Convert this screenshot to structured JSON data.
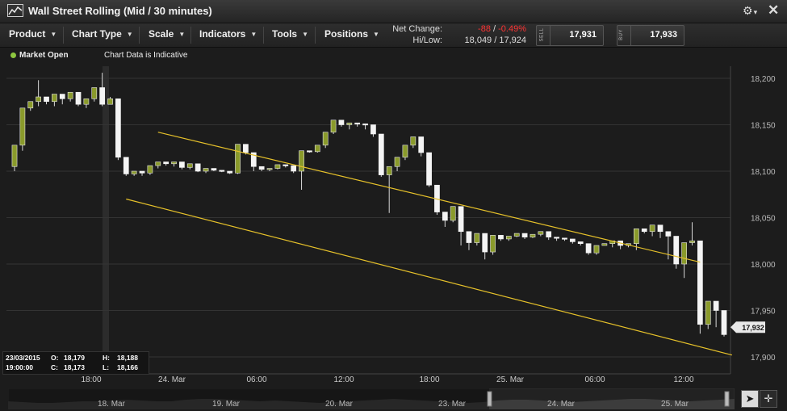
{
  "window": {
    "title": "Wall Street Rolling (Mid / 30 minutes)",
    "gear_icon": "gear-icon",
    "close_icon": "close-icon"
  },
  "toolbar": {
    "menus": [
      {
        "label": "Product"
      },
      {
        "label": "Chart Type"
      },
      {
        "label": "Scale"
      },
      {
        "label": "Indicators"
      },
      {
        "label": "Tools"
      },
      {
        "label": "Positions"
      }
    ],
    "net_change_label": "Net Change:",
    "net_change_points": "-88",
    "net_change_sep": "/",
    "net_change_pct": "-0.49%",
    "hilow_label": "Hi/Low:",
    "hilow_value": "18,049 / 17,924",
    "sell_label": "SELL",
    "sell_price": "17,931",
    "buy_label": "BUY",
    "buy_price": "17,933"
  },
  "status": {
    "market": "Market Open",
    "note": "Chart Data is Indicative",
    "market_color": "#8dc63f"
  },
  "ohlc_panel": {
    "date": "23/03/2015",
    "time": "19:00:00",
    "o_label": "O:",
    "o": "18,179",
    "c_label": "C:",
    "c": "18,173",
    "h_label": "H:",
    "h": "18,188",
    "l_label": "L:",
    "l": "18,166"
  },
  "chart_data": {
    "type": "candlestick",
    "title": "Wall Street Rolling (Mid / 30 minutes)",
    "y_ticks": [
      "18,200",
      "18,150",
      "18,100",
      "18,050",
      "18,000",
      "17,950",
      "17,900"
    ],
    "y_tick_values": [
      18200,
      18150,
      18100,
      18050,
      18000,
      17950,
      17900
    ],
    "ylim": [
      17885,
      18225
    ],
    "current_price": 17932,
    "current_price_label": "17,932",
    "x_ticks": [
      "18:00",
      "24. Mar",
      "06:00",
      "12:00",
      "18:00",
      "25. Mar",
      "06:00",
      "12:00"
    ],
    "bull_color": "#8a9a2b",
    "bear_color": "#f4f4f4",
    "candles": [
      [
        18105,
        18128,
        18100,
        18100
      ],
      [
        18128,
        18168,
        18122,
        18122
      ],
      [
        18168,
        18175,
        18165,
        18160
      ],
      [
        18175,
        18180,
        18170,
        18198
      ],
      [
        18180,
        18175,
        18172,
        18172
      ],
      [
        18175,
        18183,
        18170,
        18170
      ],
      [
        18183,
        18178,
        18172,
        18172
      ],
      [
        18178,
        18185,
        18175,
        18175
      ],
      [
        18185,
        18172,
        18170,
        18170
      ],
      [
        18172,
        18178,
        18168,
        18168
      ],
      [
        18178,
        18190,
        18175,
        18175
      ],
      [
        18190,
        18172,
        18170,
        18206
      ],
      [
        18172,
        18178,
        18172,
        18180
      ],
      [
        18178,
        18115,
        18112,
        18112
      ],
      [
        18115,
        18097,
        18095,
        18095
      ],
      [
        18097,
        18100,
        18095,
        18092
      ],
      [
        18100,
        18098,
        18095,
        18093
      ],
      [
        18098,
        18106,
        18096,
        18096
      ],
      [
        18106,
        18110,
        18103,
        18103
      ],
      [
        18110,
        18108,
        18106,
        18106
      ],
      [
        18108,
        18110,
        18105,
        18105
      ],
      [
        18110,
        18104,
        18102,
        18102
      ],
      [
        18104,
        18108,
        18102,
        18102
      ],
      [
        18108,
        18100,
        18099,
        18099
      ],
      [
        18100,
        18103,
        18098,
        18098
      ],
      [
        18103,
        18101,
        18100,
        18100
      ],
      [
        18101,
        18100,
        18099,
        18099
      ],
      [
        18100,
        18098,
        18097,
        18097
      ],
      [
        18098,
        18129,
        18097,
        18097
      ],
      [
        18129,
        18120,
        18118,
        18118
      ],
      [
        18120,
        18105,
        18100,
        18100
      ],
      [
        18105,
        18102,
        18100,
        18100
      ],
      [
        18102,
        18103,
        18100,
        18100
      ],
      [
        18103,
        18107,
        18102,
        18102
      ],
      [
        18107,
        18106,
        18104,
        18104
      ],
      [
        18106,
        18100,
        18098,
        18098
      ],
      [
        18100,
        18122,
        18080,
        18080
      ],
      [
        18122,
        18121,
        18120,
        18120
      ],
      [
        18121,
        18128,
        18120,
        18120
      ],
      [
        18128,
        18142,
        18125,
        18125
      ],
      [
        18142,
        18155,
        18140,
        18140
      ],
      [
        18155,
        18150,
        18148,
        18148
      ],
      [
        18150,
        18152,
        18145,
        18145
      ],
      [
        18152,
        18151,
        18148,
        18148
      ],
      [
        18151,
        18150,
        18145,
        18145
      ],
      [
        18150,
        18140,
        18137,
        18137
      ],
      [
        18140,
        18096,
        18094,
        18094
      ],
      [
        18096,
        18105,
        18055,
        18055
      ],
      [
        18105,
        18115,
        18100,
        18100
      ],
      [
        18115,
        18128,
        18112,
        18112
      ],
      [
        18128,
        18137,
        18125,
        18125
      ],
      [
        18137,
        18120,
        18116,
        18116
      ],
      [
        18120,
        18085,
        18083,
        18083
      ],
      [
        18085,
        18056,
        18053,
        18053
      ],
      [
        18056,
        18047,
        18040,
        18040
      ],
      [
        18047,
        18062,
        18045,
        18045
      ],
      [
        18062,
        18035,
        18020,
        18020
      ],
      [
        18035,
        18023,
        18015,
        18015
      ],
      [
        18023,
        18033,
        18020,
        18020
      ],
      [
        18033,
        18013,
        18005,
        18005
      ],
      [
        18013,
        18031,
        18010,
        18010
      ],
      [
        18031,
        18027,
        18025,
        18025
      ],
      [
        18027,
        18030,
        18025,
        18025
      ],
      [
        18030,
        18033,
        18029,
        18029
      ],
      [
        18033,
        18029,
        18027,
        18027
      ],
      [
        18029,
        18032,
        18028,
        18028
      ],
      [
        18032,
        18035,
        18030,
        18030
      ],
      [
        18035,
        18029,
        18026,
        18026
      ],
      [
        18029,
        18028,
        18025,
        18025
      ],
      [
        18028,
        18027,
        18025,
        18025
      ],
      [
        18027,
        18024,
        18022,
        18022
      ],
      [
        18024,
        18022,
        18020,
        18020
      ],
      [
        18022,
        18012,
        18010,
        18010
      ],
      [
        18012,
        18020,
        18010,
        18010
      ],
      [
        18020,
        18022,
        18020,
        18020
      ],
      [
        18022,
        18025,
        18018,
        18018
      ],
      [
        18025,
        18020,
        18016,
        18016
      ],
      [
        18020,
        18022,
        18018,
        18018
      ],
      [
        18022,
        18038,
        18015,
        18015
      ],
      [
        18038,
        18035,
        18033,
        18033
      ],
      [
        18035,
        18042,
        18030,
        18030
      ],
      [
        18042,
        18035,
        18028,
        18028
      ],
      [
        18035,
        18030,
        18005,
        18005
      ],
      [
        18030,
        18000,
        17995,
        17995
      ],
      [
        18000,
        18023,
        17985,
        17985
      ],
      [
        18023,
        18025,
        18020,
        18045
      ],
      [
        18025,
        17935,
        17925,
        17925
      ],
      [
        17935,
        17960,
        17930,
        17930
      ],
      [
        17960,
        17950,
        17932,
        17932
      ],
      [
        17950,
        17924,
        17922,
        17922
      ]
    ],
    "trendlines": [
      {
        "x0": 18,
        "y0": 18142,
        "x1": 86,
        "y1": 18002
      },
      {
        "x0": 14,
        "y0": 18070,
        "x1": 90,
        "y1": 17902
      }
    ],
    "navigator_labels": [
      "18. Mar",
      "19. Mar",
      "20. Mar",
      "23. Mar",
      "24. Mar",
      "25. Mar"
    ]
  }
}
